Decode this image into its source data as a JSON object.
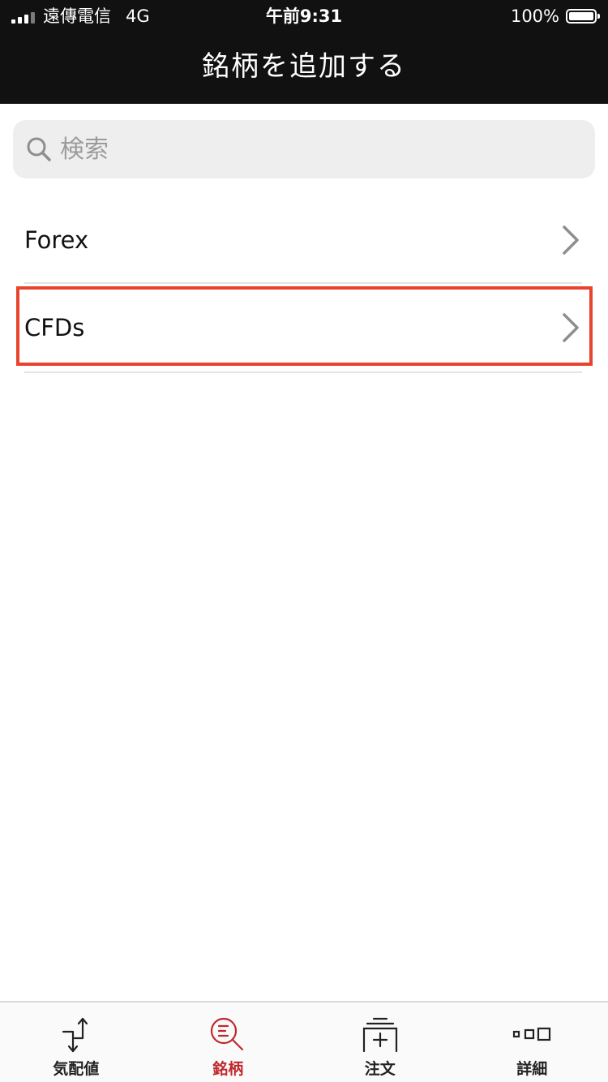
{
  "status_bar": {
    "carrier": "遠傳電信",
    "network": "4G",
    "time": "午前9:31",
    "battery": "100%"
  },
  "header": {
    "title": "銘柄を追加する"
  },
  "search": {
    "placeholder": "検索",
    "value": ""
  },
  "list": {
    "items": [
      {
        "label": "Forex"
      },
      {
        "label": "CFDs"
      }
    ]
  },
  "tabbar": {
    "tabs": [
      {
        "label": "気配値",
        "icon": "quotes-icon"
      },
      {
        "label": "銘柄",
        "icon": "symbols-search-icon"
      },
      {
        "label": "注文",
        "icon": "order-icon"
      },
      {
        "label": "詳細",
        "icon": "more-icon"
      }
    ],
    "active_index": 1
  },
  "colors": {
    "header_bg": "#111111",
    "accent": "#c0282d",
    "highlight_border": "#e8432c",
    "search_bg": "#eeeeee"
  }
}
